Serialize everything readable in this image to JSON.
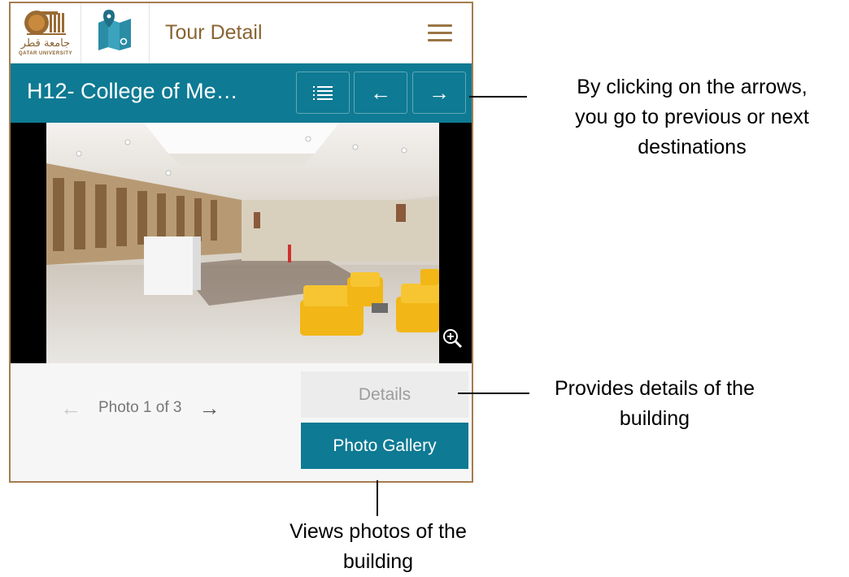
{
  "app_bar": {
    "title": "Tour Detail",
    "logo": {
      "arabic_text": "جامعة قطر",
      "english_text": "QATAR UNIVERSITY"
    },
    "map_icon": "map-icon",
    "menu_icon": "hamburger-menu-icon"
  },
  "destination": {
    "title": "H12- College of Me…",
    "list_icon": "list-icon",
    "prev_arrow": "←",
    "next_arrow": "→"
  },
  "photo": {
    "zoom_icon": "zoom-in-icon"
  },
  "pager": {
    "prev_arrow": "←",
    "label": "Photo 1 of 3",
    "next_arrow": "→"
  },
  "buttons": {
    "details": "Details",
    "photo_gallery": "Photo Gallery"
  },
  "annotations": {
    "arrows": [
      "By clicking on the arrows,",
      "you go to previous or next",
      "destinations"
    ],
    "details": [
      "Provides details of the",
      "building"
    ],
    "gallery": [
      "Views photos of the",
      "building"
    ]
  },
  "colors": {
    "teal": "#0e7a93",
    "gold": "#a47d4f",
    "light_gray": "#ececec"
  }
}
